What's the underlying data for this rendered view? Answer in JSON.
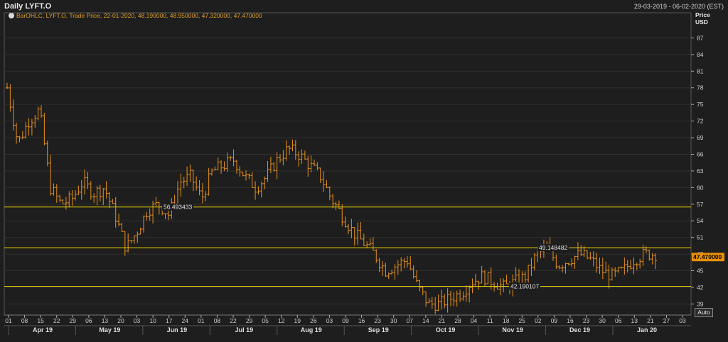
{
  "header": {
    "title": "Daily LYFT.O",
    "date_range": "29-03-2019 - 06-02-2020 (EST)",
    "legend_text": "BarOHLC, LYFT.O, Trade Price, 22-01-2020, 48.190000, 48.950000, 47.320000, 47.470000",
    "price_label": "Price",
    "currency_label": "USD",
    "auto_label": "Auto"
  },
  "colors": {
    "background": "#1e1e1e",
    "grid": "#2f2f2f",
    "bars": "#e8901a",
    "hlines": "#e8d400",
    "last_price_bg": "#e89000"
  },
  "chart_data": {
    "type": "bar",
    "title": "Daily LYFT.O",
    "ylabel": "Price USD",
    "ylim": [
      37,
      90
    ],
    "y_ticks": [
      "39",
      "42",
      "45",
      "48",
      "51",
      "54",
      "57",
      "60",
      "63",
      "66",
      "69",
      "72",
      "75",
      "78",
      "81",
      "84",
      "87"
    ],
    "x_tick_labels": [
      "01",
      "08",
      "15",
      "22",
      "29",
      "06",
      "13",
      "20",
      "03",
      "10",
      "17",
      "24",
      "01",
      "08",
      "22",
      "29",
      "05",
      "12",
      "19",
      "26",
      "03",
      "09",
      "16",
      "23",
      "30",
      "07",
      "14",
      "21",
      "28",
      "04",
      "11",
      "18",
      "25",
      "02",
      "09",
      "16",
      "23",
      "30",
      "06",
      "13",
      "21",
      "27",
      "03"
    ],
    "month_labels": [
      "Apr 19",
      "May 19",
      "Jun 19",
      "Jul 19",
      "Aug 19",
      "Sep 19",
      "Oct 19",
      "Nov 19",
      "Dec 19",
      "Jan 20"
    ],
    "horizontal_lines": [
      {
        "value": 56.493433,
        "label": "56.493433"
      },
      {
        "value": 49.148482,
        "label": "49.148482"
      },
      {
        "value": 42.190107,
        "label": "42.190107"
      }
    ],
    "last_price": "47.470000",
    "ohlc_anchor_closes": [
      78,
      68,
      72,
      74,
      60,
      57,
      58,
      61,
      59,
      60,
      55,
      49,
      52,
      56,
      57,
      55,
      61,
      62,
      58,
      63,
      64,
      65,
      62,
      60,
      62,
      65,
      67,
      66,
      64,
      62,
      58,
      55,
      52,
      50,
      48,
      45,
      46,
      47,
      42,
      39,
      39,
      40,
      41,
      43,
      44,
      43,
      42,
      43,
      44,
      48,
      49,
      46,
      47,
      48,
      47,
      45,
      44,
      45,
      47,
      48,
      48
    ]
  }
}
